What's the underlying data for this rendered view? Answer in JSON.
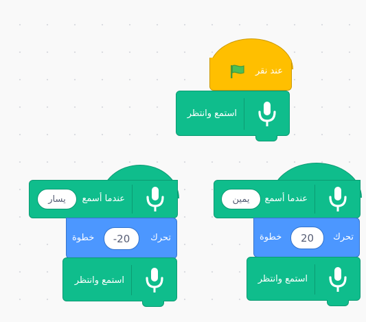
{
  "canvas": {
    "background": "#f9f9f9",
    "dot_color": "#d9dbe0"
  },
  "colors": {
    "extension": "#0fbd8c",
    "motion": "#4c97ff",
    "events": "#ffbf00",
    "text": "#ffffff"
  },
  "stack_top": {
    "hat": {
      "label": "عند نقر",
      "icon": "green-flag-icon"
    },
    "listen": {
      "label": "استمع وانتظر",
      "icon": "microphone-icon"
    }
  },
  "stack_right": {
    "hat": {
      "label": "عندما أسمع",
      "value": "يمين",
      "icon": "microphone-icon"
    },
    "move": {
      "label_before": "تحرك",
      "value": "20",
      "label_after": "خطوة"
    },
    "listen": {
      "label": "استمع وانتظر",
      "icon": "microphone-icon"
    }
  },
  "stack_left": {
    "hat": {
      "label": "عندما أسمع",
      "value": "يسار",
      "icon": "microphone-icon"
    },
    "move": {
      "label_before": "تحرك",
      "value": "-20",
      "label_after": "خطوة"
    },
    "listen": {
      "label": "استمع وانتظر",
      "icon": "microphone-icon"
    }
  }
}
